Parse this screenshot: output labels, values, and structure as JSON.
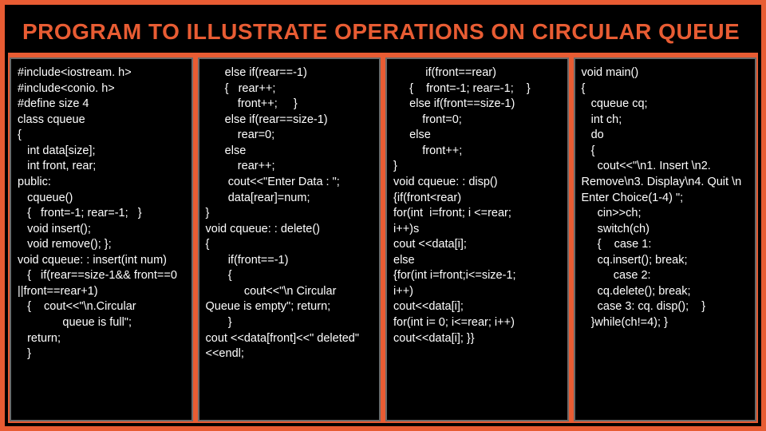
{
  "title": "PROGRAM TO ILLUSTRATE OPERATIONS ON CIRCULAR QUEUE",
  "cols": {
    "c1": "#include<iostream. h>\n#include<conio. h>\n#define size 4\nclass cqueue\n{\n   int data[size];\n   int front, rear;\npublic:\n   cqueue()\n   {   front=-1; rear=-1;   }\n   void insert();\n   void remove(); };\nvoid cqueue: : insert(int num)\n   {   if(rear==size-1&& front==0 ||front==rear+1)\n   {    cout<<\"\\n.Circular\n              queue is full\";\n   return;\n   }",
    "c2": "      else if(rear==-1)\n      {   rear++;\n          front++;     }\n      else if(rear==size-1)\n          rear=0;\n      else\n          rear++;\n       cout<<\"Enter Data : \";\n       data[rear]=num;\n}\nvoid cqueue: : delete()\n{\n       if(front==-1)\n       {\n            cout<<\"\\n Circular Queue is empty\"; return;\n       }\ncout <<data[front]<<\" deleted\"<<endl;",
    "c3": "          if(front==rear)\n     {    front=-1; rear=-1;    }\n     else if(front==size-1)\n         front=0;\n     else\n         front++;\n}\nvoid cqueue: : disp()\n{if(front<rear)\nfor(int  i=front; i <=rear;\ni++)s\ncout <<data[i];\nelse\n{for(int i=front;i<=size-1;\ni++)\ncout<<data[i];\nfor(int i= 0; i<=rear; i++)\ncout<<data[i]; }}",
    "c4": "void main()\n{\n   cqueue cq;\n   int ch;\n   do\n   {\n     cout<<\"\\n1. Insert \\n2. Remove\\n3. Display\\n4. Quit \\n Enter Choice(1-4) \";\n     cin>>ch;\n     switch(ch)\n     {    case 1:\n     cq.insert(); break;\n          case 2:\n     cq.delete(); break;\n     case 3: cq. disp();    }\n   }while(ch!=4); }"
  }
}
